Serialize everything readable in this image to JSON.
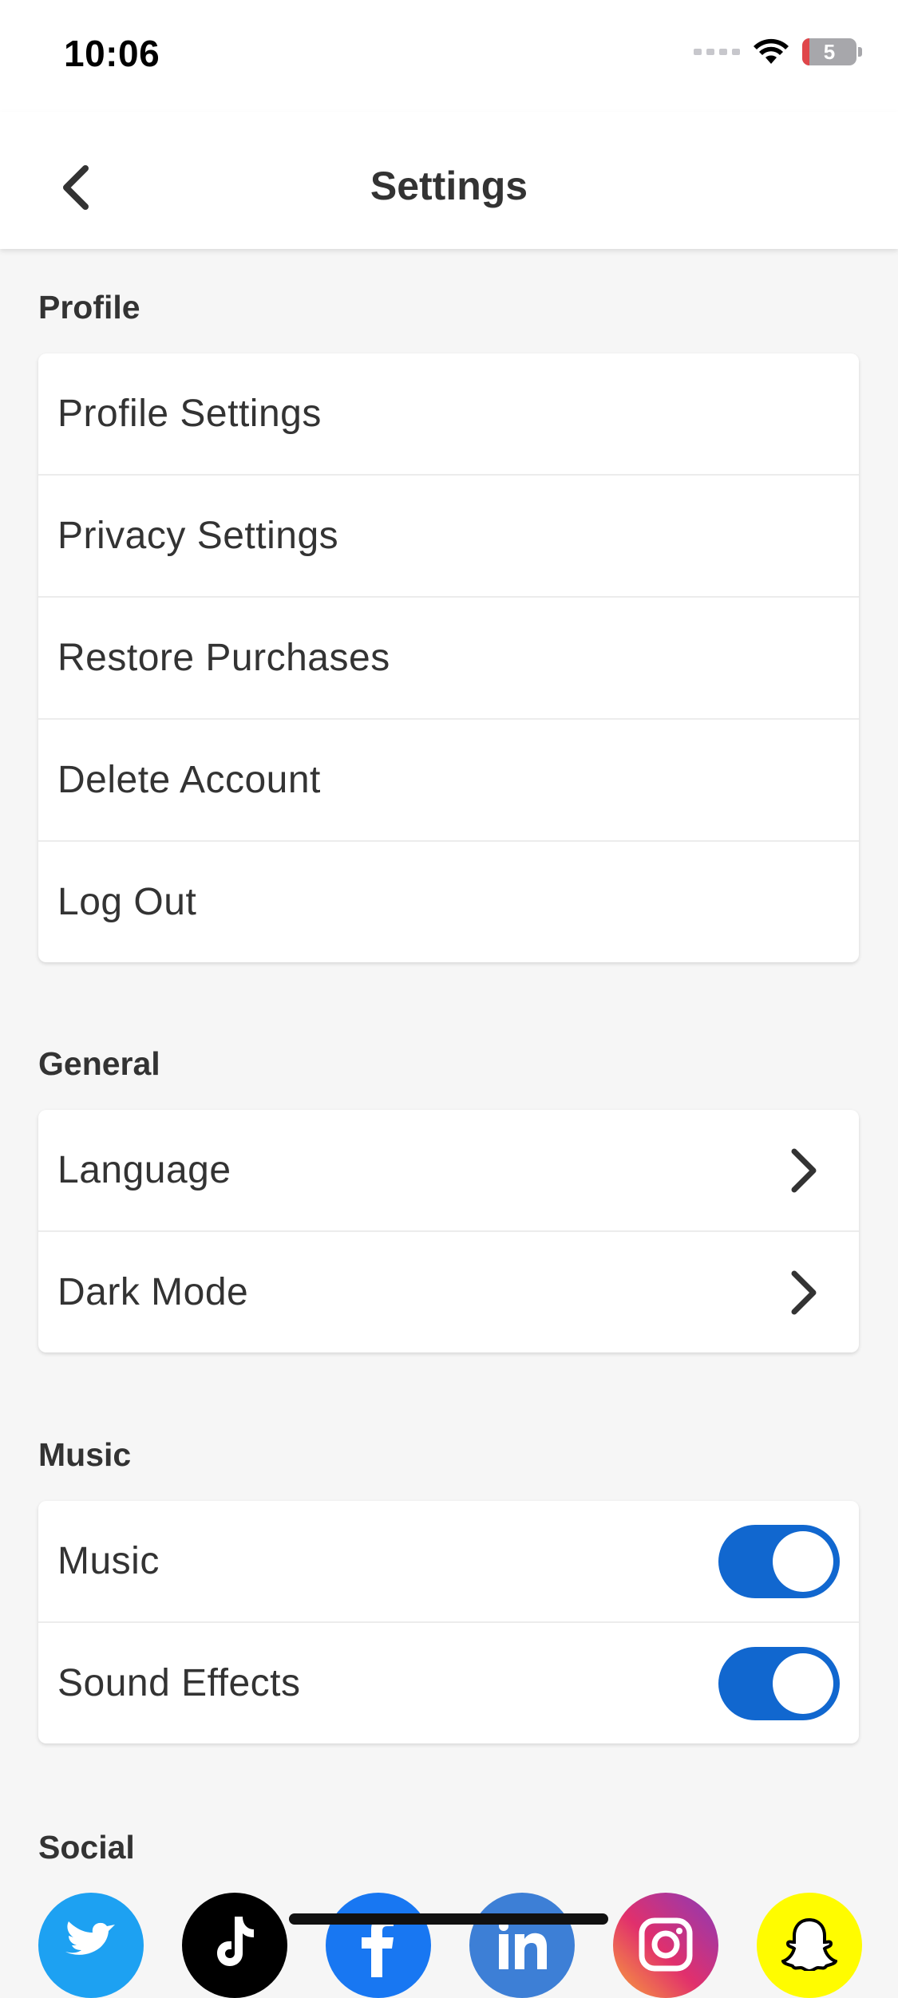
{
  "status_bar": {
    "time": "10:06",
    "battery": "5"
  },
  "nav": {
    "title": "Settings",
    "back_icon": "chevron-left-icon"
  },
  "sections": {
    "profile": {
      "header": "Profile",
      "items": [
        {
          "label": "Profile Settings"
        },
        {
          "label": "Privacy Settings"
        },
        {
          "label": "Restore Purchases"
        },
        {
          "label": "Delete Account"
        },
        {
          "label": "Log Out"
        }
      ]
    },
    "general": {
      "header": "General",
      "items": [
        {
          "label": "Language",
          "icon": "chevron-right-icon"
        },
        {
          "label": "Dark Mode",
          "icon": "chevron-right-icon"
        }
      ]
    },
    "music": {
      "header": "Music",
      "items": [
        {
          "label": "Music",
          "toggle_on": true
        },
        {
          "label": "Sound Effects",
          "toggle_on": true
        }
      ]
    },
    "social": {
      "header": "Social",
      "icons": [
        "twitter-icon",
        "tiktok-icon",
        "facebook-icon",
        "linkedin-icon",
        "instagram-icon",
        "snapchat-icon"
      ]
    }
  },
  "colors": {
    "accent": "#1167cf",
    "twitter": "#1da1f2",
    "tiktok": "#000000",
    "facebook": "#1877f2",
    "linkedin": "#3d7fd6",
    "snapchat": "#fffc00"
  }
}
